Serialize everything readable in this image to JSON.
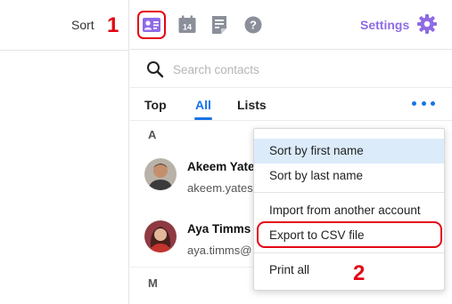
{
  "left_pane": {
    "sort_label": "Sort"
  },
  "annotations": {
    "step1": "1",
    "step2": "2"
  },
  "toolbar": {
    "icons": [
      "contacts-card-icon",
      "calendar-icon",
      "notes-icon",
      "help-icon",
      "gear-icon"
    ],
    "calendar_day": "14",
    "settings_label": "Settings"
  },
  "search": {
    "placeholder": "Search contacts",
    "value": ""
  },
  "tabs": [
    {
      "label": "Top"
    },
    {
      "label": "All",
      "active": true
    },
    {
      "label": "Lists"
    }
  ],
  "sections": {
    "a": "A",
    "m": "M"
  },
  "contacts": [
    {
      "name": "Akeem Yates",
      "email": "akeem.yates@"
    },
    {
      "name": "Aya Timms",
      "email": "aya.timms@"
    }
  ],
  "menu": {
    "items": [
      {
        "label": "Sort by first name",
        "highlighted": true
      },
      {
        "label": "Sort by last name"
      },
      {
        "label": "Import from another account"
      },
      {
        "label": "Export to CSV file",
        "annotated": true
      },
      {
        "label": "Print all"
      }
    ]
  },
  "colors": {
    "accent_blue": "#1a73e8",
    "settings_purple": "#8e6be6",
    "annotation_red": "#e30613",
    "menu_highlight": "#dcebfa"
  }
}
